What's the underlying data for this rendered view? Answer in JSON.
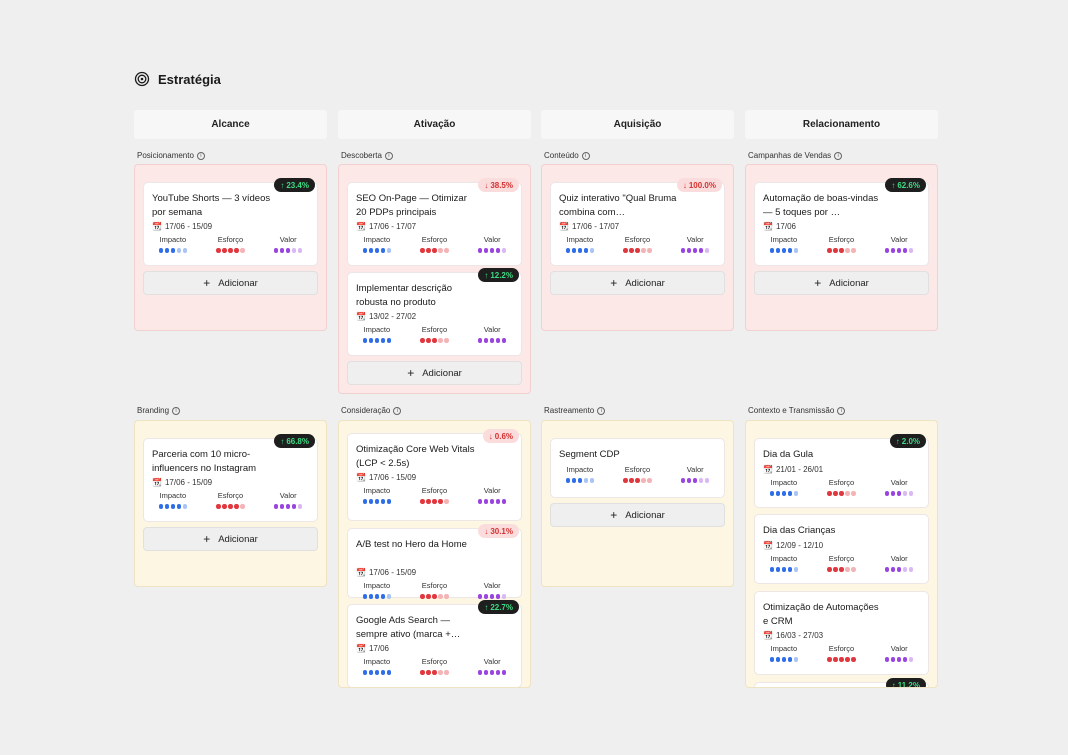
{
  "header": {
    "title": "Estratégia",
    "icon": "target-icon"
  },
  "columns": [
    "Alcance",
    "Ativação",
    "Aquisição",
    "Relacionamento"
  ],
  "add_label": "Adicionar",
  "metric_labels": [
    "Impacto",
    "Esforço",
    "Valor"
  ],
  "colors": {
    "impacto": "#2f6ee8",
    "impacto_light": "#a9c4f5",
    "esforco": "#e0383e",
    "esforco_light": "#f4b3b5",
    "valor": "#9a45e0",
    "valor_light": "#d9b8f3",
    "up": "#3ddc84",
    "down": "#d63030"
  },
  "sections": [
    {
      "label": "Posicionamento",
      "cards": [
        {
          "title": "YouTube Shorts — 3 vídeos por semana",
          "date": "17/06 - 15/09",
          "badge": "23.4%",
          "trend": "up",
          "impacto": 3,
          "esforco": 4,
          "valor": 3
        }
      ]
    },
    {
      "label": "Descoberta",
      "cards": [
        {
          "title": "SEO On-Page — Otimizar 20 PDPs principais",
          "date": "17/06 - 17/07",
          "badge": "38.5%",
          "trend": "down",
          "impacto": 4,
          "esforco": 3,
          "valor": 4
        },
        {
          "title": "Implementar descrição robusta no produto",
          "date": "13/02 - 27/02",
          "badge": "12.2%",
          "trend": "up",
          "impacto": 5,
          "esforco": 3,
          "valor": 5
        }
      ]
    },
    {
      "label": "Conteúdo",
      "cards": [
        {
          "title": "Quiz interativo \"Qual Bruma combina com…",
          "date": "17/06 - 17/07",
          "badge": "100.0%",
          "trend": "down",
          "impacto": 4,
          "esforco": 3,
          "valor": 4
        }
      ]
    },
    {
      "label": "Campanhas de Vendas",
      "cards": [
        {
          "title": "Automação de boas-vindas — 5 toques por …",
          "date": "17/06",
          "badge": "62.6%",
          "trend": "up",
          "impacto": 4,
          "esforco": 3,
          "valor": 4
        }
      ]
    },
    {
      "label": "Branding",
      "cards": [
        {
          "title": "Parceria com 10 micro-influencers no Instagram",
          "date": "17/06 - 15/09",
          "badge": "66.8%",
          "trend": "up",
          "impacto": 4,
          "esforco": 4,
          "valor": 4
        }
      ]
    },
    {
      "label": "Consideração",
      "cards": [
        {
          "title": "Otimização Core Web Vitals (LCP < 2.5s)",
          "date": "17/06 - 15/09",
          "badge": "0.6%",
          "trend": "down",
          "impacto": 5,
          "esforco": 4,
          "valor": 5
        },
        {
          "title": "A/B test no Hero da Home",
          "date": "17/06 - 15/09",
          "badge": "30.1%",
          "trend": "down",
          "impacto": 4,
          "esforco": 3,
          "valor": 4
        },
        {
          "title": "Google Ads Search — sempre ativo (marca +…",
          "date": "17/06",
          "badge": "22.7%",
          "trend": "up",
          "impacto": 5,
          "esforco": 3,
          "valor": 5
        }
      ]
    },
    {
      "label": "Rastreamento",
      "cards": [
        {
          "title": "Segment CDP",
          "date": "",
          "badge": "",
          "trend": "",
          "impacto": 3,
          "esforco": 3,
          "valor": 3
        }
      ]
    },
    {
      "label": "Contexto e Transmissão",
      "cards": [
        {
          "title": "Dia da Gula",
          "date": "21/01 - 26/01",
          "badge": "2.0%",
          "trend": "up",
          "impacto": 4,
          "esforco": 3,
          "valor": 3
        },
        {
          "title": "Dia das Crianças",
          "date": "12/09 - 12/10",
          "badge": "",
          "trend": "",
          "impacto": 4,
          "esforco": 3,
          "valor": 3
        },
        {
          "title": "Otimização de Automações e CRM",
          "date": "16/03 - 27/03",
          "badge": "",
          "trend": "",
          "impacto": 4,
          "esforco": 5,
          "valor": 4
        },
        {
          "title": "",
          "date": "",
          "badge": "11.2%",
          "trend": "up",
          "impacto": 0,
          "esforco": 0,
          "valor": 0
        }
      ]
    }
  ]
}
